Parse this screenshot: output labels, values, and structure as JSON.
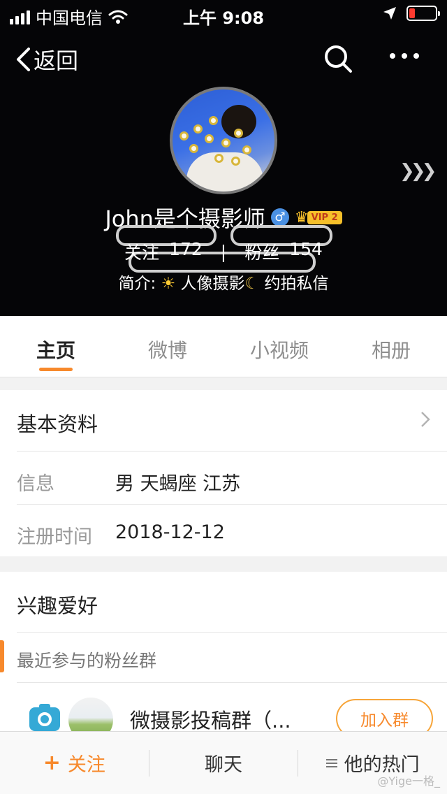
{
  "status_bar": {
    "carrier": "中国电信",
    "time": "上午 9:08",
    "battery_color": "#ff3b30"
  },
  "nav": {
    "back_label": "返回"
  },
  "profile": {
    "name": "John是个摄影师",
    "gender_symbol": "♂",
    "vip_label": "VIP 2",
    "following_label": "关注",
    "following_count": "172",
    "separator": "|",
    "followers_label": "粉丝",
    "followers_count": "154",
    "intro_prefix": "简介:",
    "intro_text": "人像摄影",
    "intro_suffix": "约拍私信"
  },
  "tabs": [
    {
      "label": "主页",
      "active": true
    },
    {
      "label": "微博"
    },
    {
      "label": "小视频"
    },
    {
      "label": "相册"
    }
  ],
  "basic_info": {
    "title": "基本资料",
    "info_label": "信息",
    "info_value": "男  天蝎座  江苏",
    "register_label": "注册时间",
    "register_value": "2018-12-12"
  },
  "interests": {
    "title": "兴趣爱好",
    "groups_heading": "最近参与的粉丝群",
    "group_name": "微摄影投稿群（...",
    "join_label": "加入群"
  },
  "bottom_bar": {
    "follow_label": "关注",
    "chat_label": "聊天",
    "hot_label": "他的热门"
  },
  "watermark": "@Yige一格_",
  "colors": {
    "accent": "#f7892c",
    "header_bg": "#050507",
    "vip": "#f5c02a",
    "gender": "#4a90e2"
  }
}
